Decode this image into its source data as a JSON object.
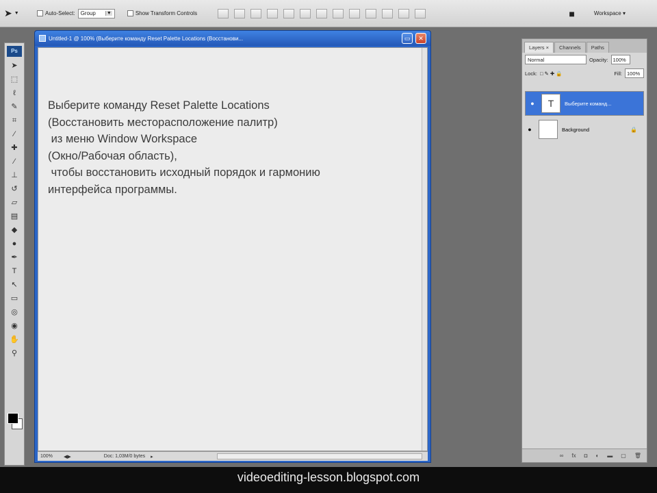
{
  "options_bar": {
    "auto_select_label": "Auto-Select:",
    "auto_select_value": "Group",
    "show_transform_label": "Show Transform Controls",
    "workspace_label": "Workspace ▾"
  },
  "document": {
    "title": "Untitled-1 @ 100% (Выберите команду Reset Palette Locations  (Восстанови...",
    "text": "Выберите команду Reset Palette Locations\n(Восстановить месторасположение палитр)\n из меню Window Workspace\n(Окно/Рабочая область),\n чтобы восстановить исходный порядок и гармонию\nинтерфейса программы.",
    "status_zoom": "100%",
    "status_doc": "Doc: 1,03M/0 bytes"
  },
  "layers_panel": {
    "tabs": [
      "Layers ×",
      "Channels",
      "Paths"
    ],
    "blend_mode": "Normal",
    "opacity_label": "Opacity:",
    "opacity_value": "100%",
    "lock_label": "Lock:",
    "fill_label": "Fill:",
    "fill_value": "100%",
    "layers": [
      {
        "name": "Выберите команд...",
        "thumb": "T",
        "selected": true
      },
      {
        "name": "Background",
        "thumb": "",
        "selected": false
      }
    ]
  },
  "watermark": "videoediting-lesson.blogspot.com"
}
